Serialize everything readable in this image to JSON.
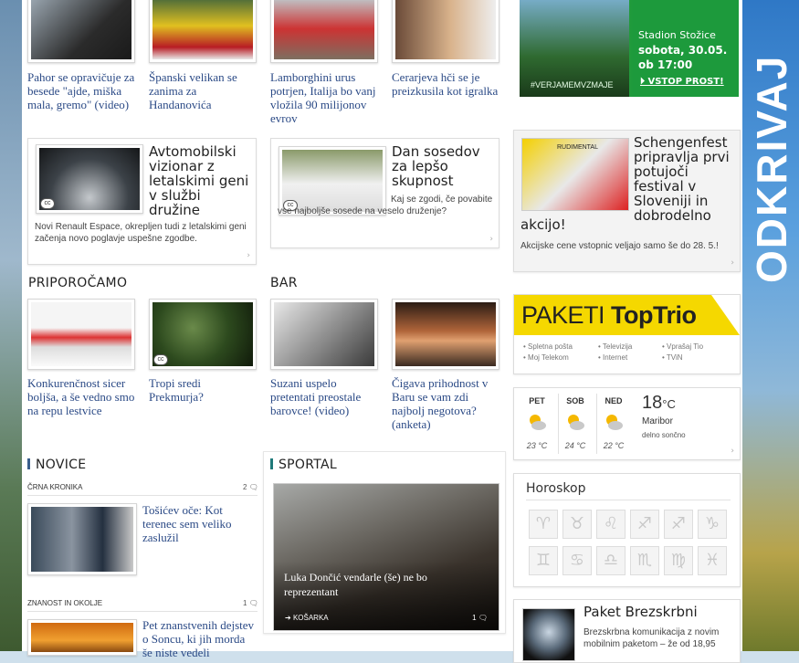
{
  "top_row": [
    {
      "caption": "Pahor se opravičuje za besede \"ajde, miška mala, gremo\" (video)"
    },
    {
      "caption": "Španski velikan se zanima za Handanovića"
    },
    {
      "caption": "Lamborghini urus potrjen, Italija bo vanj vložila 90 milijonov evrov"
    },
    {
      "caption": "Cerarjeva hči se je preizkusila kot igralka"
    }
  ],
  "feature_boxes": [
    {
      "title": "Avtomobilski vizionar z letalskimi geni v službi družine",
      "desc": "Novi Renault Espace, okrepljen tudi z letalskimi geni začenja novo poglavje uspešne zgodbe."
    },
    {
      "title": "Dan sosedov za lepšo skupnost",
      "desc": "Kaj se zgodi, če povabite vse najboljše sosede na veselo druženje?"
    }
  ],
  "section_priporocamo": "PRIPOROČAMO",
  "section_bar": "BAR",
  "second_row": [
    {
      "caption": "Konkurenčnost sicer boljša, a še vedno smo na repu lestvice"
    },
    {
      "caption": "Tropi sredi Prekmurja?"
    },
    {
      "caption": "Suzani uspelo pretentati preostale barovce! (video)"
    },
    {
      "caption": "Čigava prihodnost v Baru se vam zdi najbolj negotova? (anketa)"
    }
  ],
  "novice": {
    "title": "NOVICE",
    "items": [
      {
        "category": "ČRNA KRONIKA",
        "count": "2",
        "title": "Tošićev oče: Kot terenec sem veliko zaslužil"
      },
      {
        "category": "ZNANOST IN OKOLJE",
        "count": "1",
        "title": "Pet znanstvenih dejstev o Soncu, ki jih morda še niste vedeli"
      }
    ]
  },
  "sportal": {
    "title": "SPORTAL",
    "headline": "Luka Dončić vendarle (še) ne bo reprezentant",
    "category": "KOŠARKA",
    "count": "1"
  },
  "stadium_ad": {
    "line1": "Stadion Stožice",
    "line2": "sobota, 30.05.",
    "line3": "ob 17:00",
    "hashtag": "#VERJAMEMVZMAJE",
    "cta": "VSTOP PROST!"
  },
  "schengen": {
    "title_top": "Schengenfest pripravlja prvi potujoči festival v Sloveniji in dobrodelno",
    "title_bottom": "akcijo!",
    "desc": "Akcijske cene vstopnic veljajo samo še do 28. 5.!",
    "poster_text": "RUDIMENTAL"
  },
  "paketi": {
    "prefix": "PAKETI ",
    "brand": "TopTrio",
    "items": [
      "Spletna pošta",
      "Moj Telekom",
      "Televizija",
      "Internet",
      "Vprašaj Tio",
      "TViN"
    ]
  },
  "weather": {
    "days": [
      {
        "day": "PET",
        "temp": "23 °C"
      },
      {
        "day": "SOB",
        "temp": "24 °C"
      },
      {
        "day": "NED",
        "temp": "22 °C"
      }
    ],
    "current": "18",
    "unit": "°C",
    "city": "Maribor",
    "condition": "delno sončno"
  },
  "horoskop": {
    "title": "Horoskop",
    "signs": [
      "♈",
      "♉",
      "♌",
      "♐",
      "♐",
      "♑",
      "♊",
      "♋",
      "♎",
      "♏",
      "♍",
      "♓"
    ]
  },
  "paket_brezskrbni": {
    "title": "Paket Brezskrbni",
    "desc": "Brezskrbna komunikacija z novim mobilnim paketom – že od 18,95"
  },
  "side_brand": "ODKRIVAJ",
  "colors": {
    "link": "#2b4a86",
    "accent_green": "#1d9a3c",
    "paketi_yellow": "#f5d800"
  }
}
